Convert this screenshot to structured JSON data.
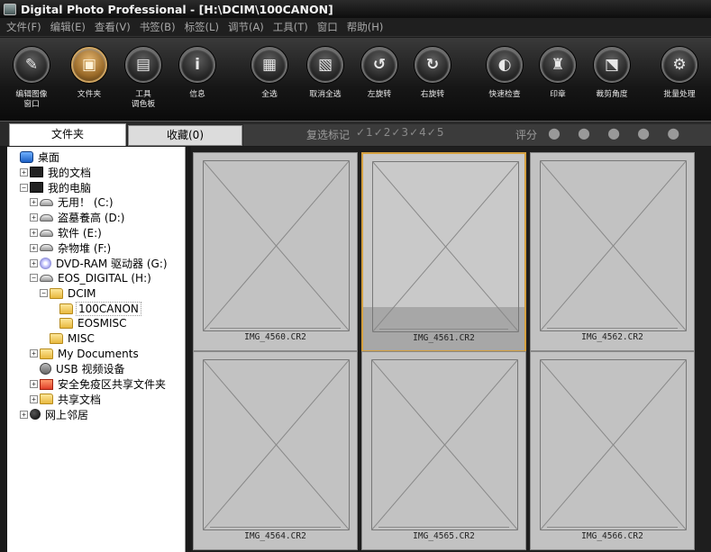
{
  "window": {
    "title": "Digital Photo Professional - [H:\\DCIM\\100CANON]"
  },
  "menu": [
    "文件(F)",
    "编辑(E)",
    "查看(V)",
    "书签(B)",
    "标签(L)",
    "调节(A)",
    "工具(T)",
    "窗口",
    "帮助(H)"
  ],
  "toolbar": {
    "items": [
      {
        "label": "编辑图像\n窗口",
        "icon": "edit-image-icon"
      },
      {
        "label": "文件夹",
        "icon": "folder-icon",
        "active": true
      },
      {
        "label": "工具\n调色板",
        "icon": "tool-palette-icon"
      },
      {
        "label": "信息",
        "icon": "info-icon"
      },
      {
        "label": "全选",
        "icon": "select-all-icon"
      },
      {
        "label": "取消全选",
        "icon": "deselect-all-icon"
      },
      {
        "label": "左旋转",
        "icon": "rotate-left-icon"
      },
      {
        "label": "右旋转",
        "icon": "rotate-right-icon"
      },
      {
        "label": "快速检查",
        "icon": "quick-check-icon"
      },
      {
        "label": "印章",
        "icon": "stamp-icon"
      },
      {
        "label": "裁剪角度",
        "icon": "crop-angle-icon"
      },
      {
        "label": "批量处理",
        "icon": "batch-process-icon"
      }
    ]
  },
  "tabs": {
    "folder": "文件夹",
    "favorites": "收藏(0)"
  },
  "ratingbar": {
    "check_label": "复选标记",
    "check_marks": "✓1✓2✓3✓4✓5",
    "rating_label": "评分",
    "rating_dots": "● ● ● ● ●"
  },
  "tree": [
    {
      "label": "桌面",
      "level": 0,
      "icon": "desk",
      "pm": ""
    },
    {
      "label": "我的文档",
      "level": 1,
      "icon": "dark",
      "pm": "+"
    },
    {
      "label": "我的电脑",
      "level": 1,
      "icon": "dark",
      "pm": "-"
    },
    {
      "label": "无用！ (C:)",
      "level": 2,
      "icon": "drive",
      "pm": "+"
    },
    {
      "label": "盗墓養高 (D:)",
      "level": 2,
      "icon": "drive",
      "pm": "+"
    },
    {
      "label": "软件 (E:)",
      "level": 2,
      "icon": "drive",
      "pm": "+"
    },
    {
      "label": "杂物堆 (F:)",
      "level": 2,
      "icon": "drive",
      "pm": "+"
    },
    {
      "label": "DVD-RAM 驱动器 (G:)",
      "level": 2,
      "icon": "cd",
      "pm": "+"
    },
    {
      "label": "EOS_DIGITAL (H:)",
      "level": 2,
      "icon": "drive",
      "pm": "-"
    },
    {
      "label": "DCIM",
      "level": 3,
      "icon": "folder",
      "pm": "-"
    },
    {
      "label": "100CANON",
      "level": 4,
      "icon": "folder",
      "pm": "",
      "selected": true
    },
    {
      "label": "EOSMISC",
      "level": 4,
      "icon": "folder",
      "pm": ""
    },
    {
      "label": "MISC",
      "level": 3,
      "icon": "folder",
      "pm": ""
    },
    {
      "label": "My Documents",
      "level": 2,
      "icon": "folder",
      "pm": "+"
    },
    {
      "label": "USB 视频设备",
      "level": 2,
      "icon": "usb",
      "pm": ""
    },
    {
      "label": "安全免疫区共享文件夹",
      "level": 2,
      "icon": "safe",
      "pm": "+"
    },
    {
      "label": "共享文档",
      "level": 2,
      "icon": "folder",
      "pm": "+"
    },
    {
      "label": "网上邻居",
      "level": 1,
      "icon": "globe",
      "pm": "+"
    }
  ],
  "thumbnails": [
    {
      "name": "IMG_4560.CR2"
    },
    {
      "name": "IMG_4561.CR2",
      "selected": true
    },
    {
      "name": "IMG_4562.CR2"
    },
    {
      "name": "IMG_4564.CR2"
    },
    {
      "name": "IMG_4565.CR2"
    },
    {
      "name": "IMG_4566.CR2"
    }
  ]
}
